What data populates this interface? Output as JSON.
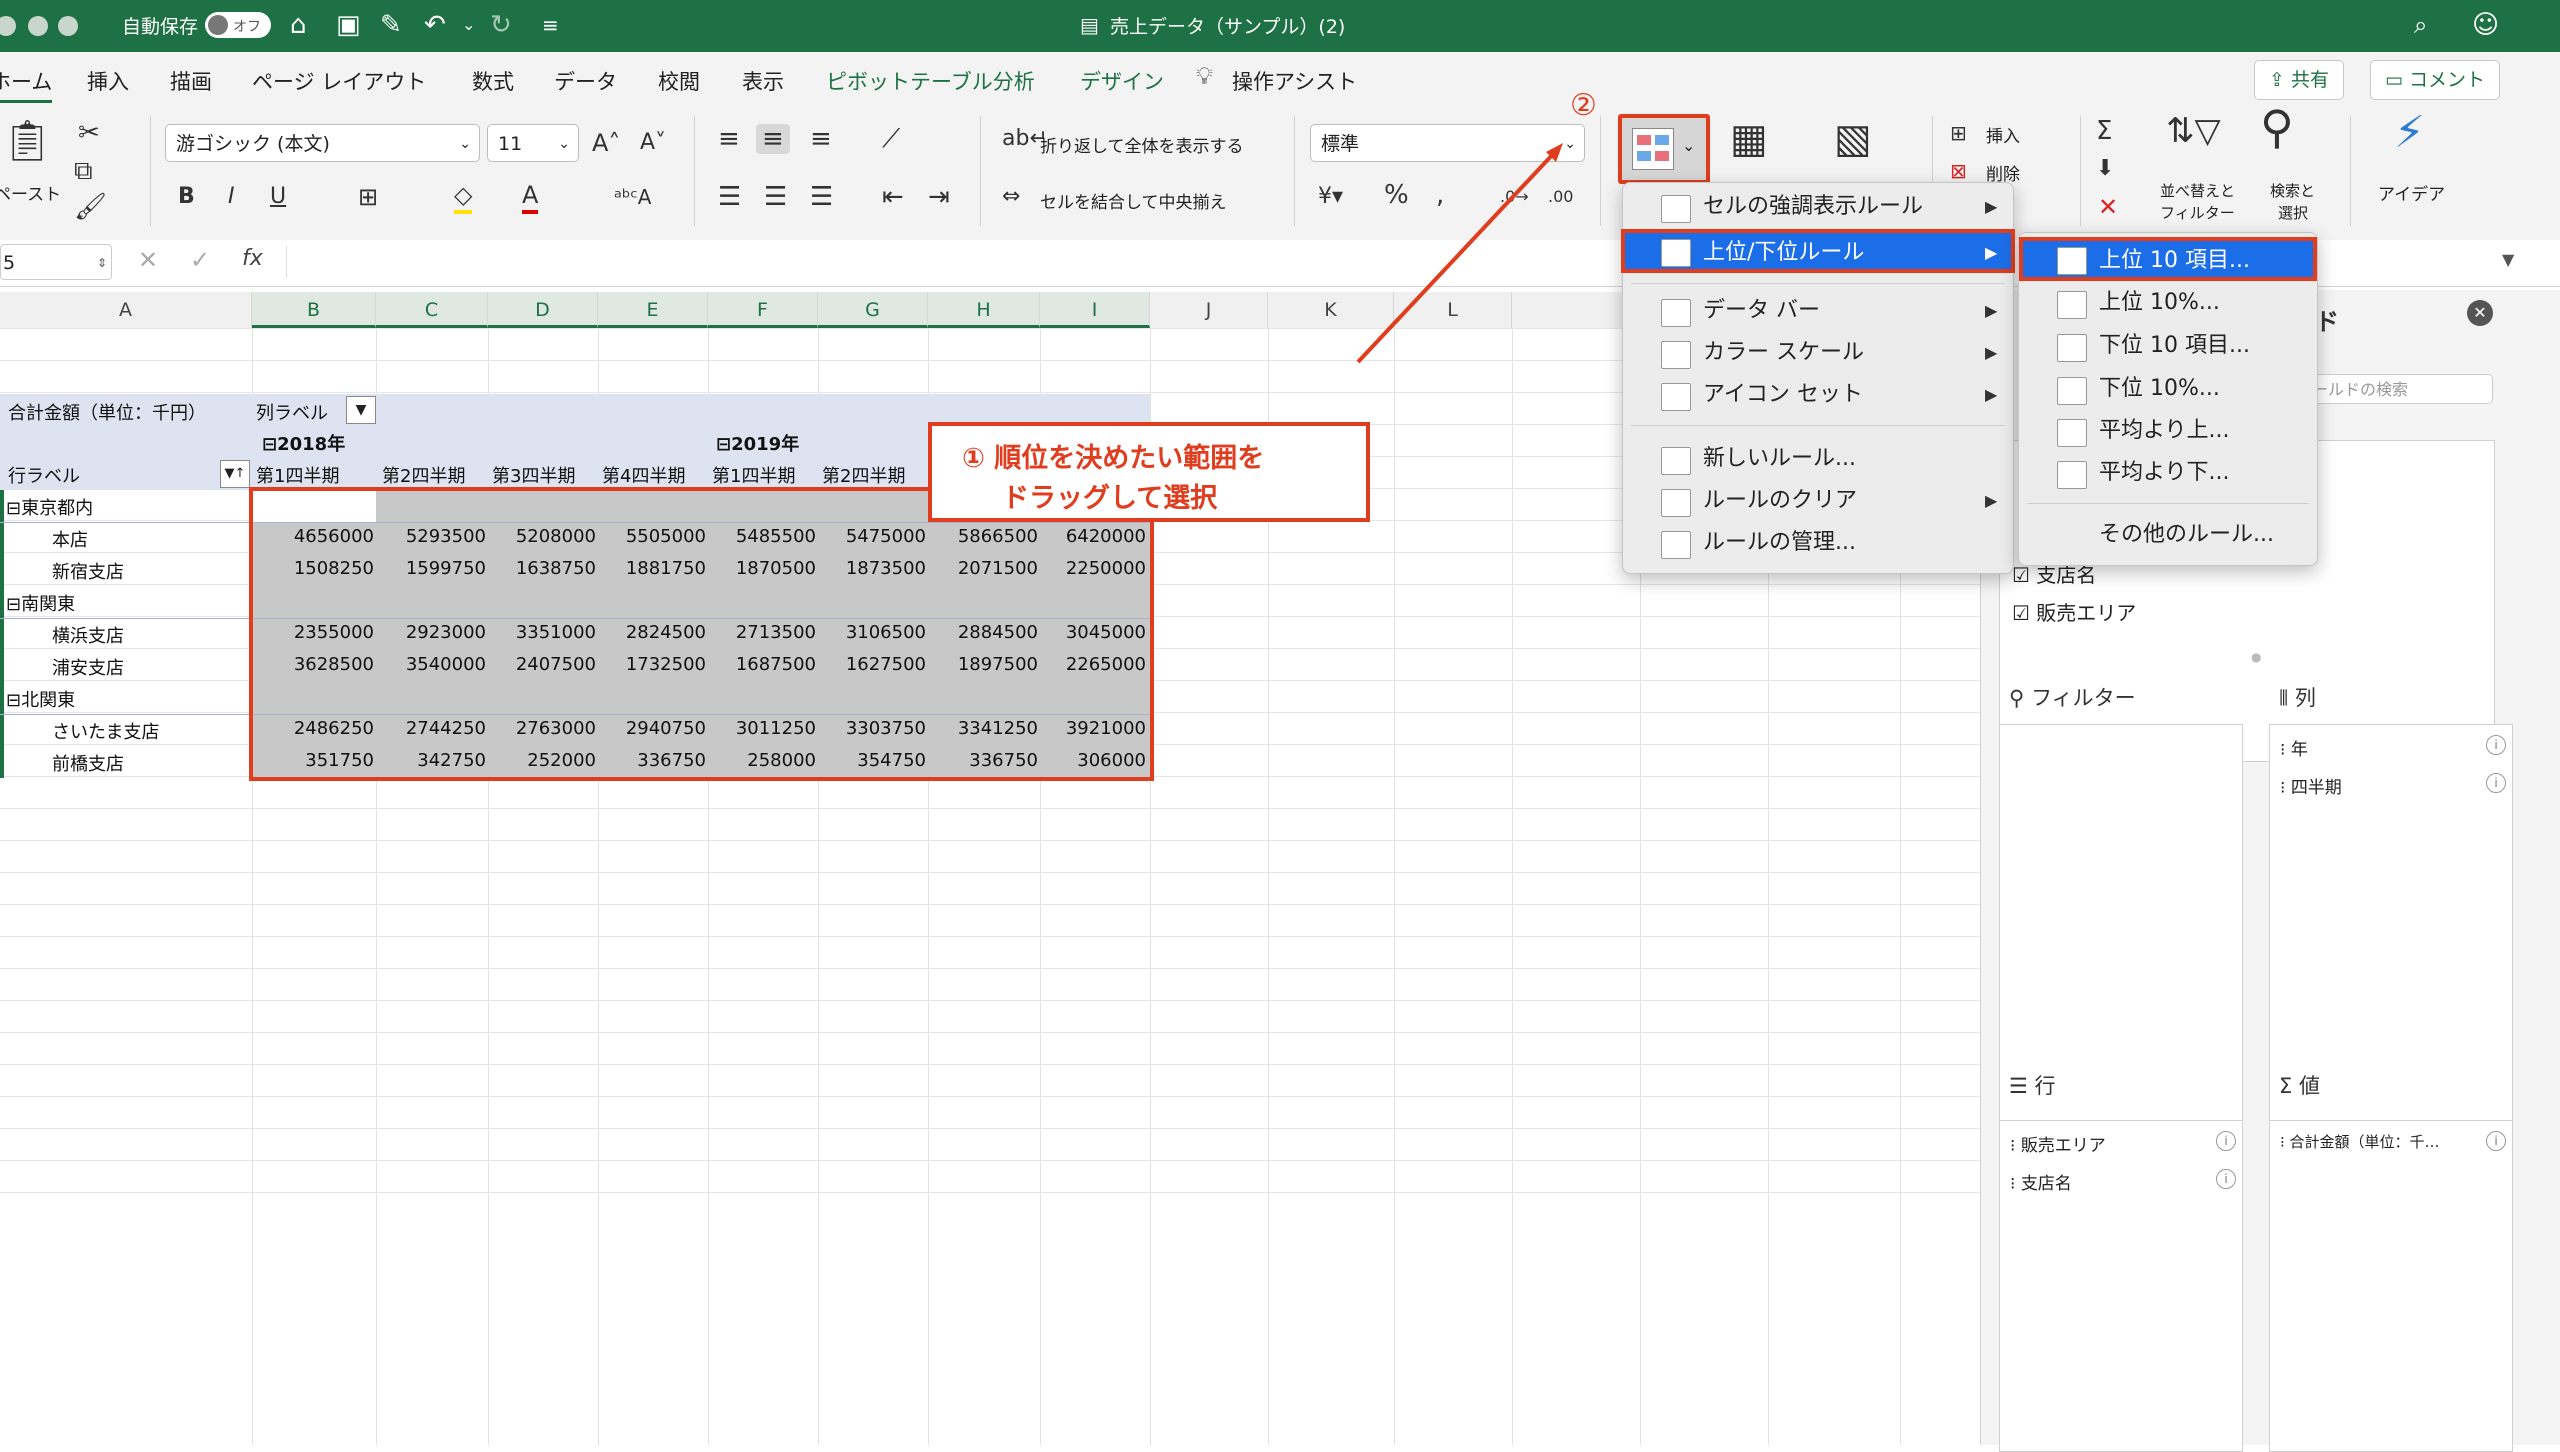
{
  "titlebar": {
    "autosave_label": "自動保存",
    "autosave_state": "オフ",
    "doc_title": "売上データ（サンプル）(2)",
    "icons": [
      "home-icon",
      "save-icon",
      "edit-icon",
      "undo-icon",
      "redo-icon",
      "customize-icon",
      "search-icon",
      "smiley-icon"
    ]
  },
  "tabs": [
    "ホーム",
    "挿入",
    "描画",
    "ページ レイアウト",
    "数式",
    "データ",
    "校閲",
    "表示",
    "ピボットテーブル分析",
    "デザイン",
    "操作アシスト"
  ],
  "share_label": "共有",
  "comment_label": "コメント",
  "ribbon": {
    "paste_label": "ペースト",
    "font_name": "游ゴシック (本文)",
    "font_size": "11",
    "bold": "B",
    "italic": "I",
    "underline": "U",
    "wrap_text": "折り返して全体を表示する",
    "merge_center": "セルを結合して中央揃え",
    "number_format": "標準",
    "insert_label": "挿入",
    "delete_label": "削除",
    "sort_filter": [
      "並べ替えと",
      "フィルター"
    ],
    "find_select": [
      "検索と",
      "選択"
    ],
    "ideas_label": "アイデア"
  },
  "formula_bar": {
    "name_box": "5",
    "fx": "fx"
  },
  "columns": [
    "A",
    "B",
    "C",
    "D",
    "E",
    "F",
    "G",
    "H",
    "I",
    "J",
    "K",
    "L"
  ],
  "pivot": {
    "corner_label": "合計金額（単位：千円）",
    "col_labels": "列ラベル",
    "row_labels": "行ラベル",
    "year_2018": "2018年",
    "year_2019": "2019年",
    "quarters": [
      "第1四半期",
      "第2四半期",
      "第3四半期",
      "第4四半期",
      "第1四半期",
      "第2四半期"
    ],
    "groups": [
      {
        "name": "東京都内",
        "rows": [
          {
            "name": "本店",
            "values": [
              "4656000",
              "5293500",
              "5208000",
              "5505000",
              "5485500",
              "5475000",
              "5866500",
              "6420000"
            ]
          },
          {
            "name": "新宿支店",
            "values": [
              "1508250",
              "1599750",
              "1638750",
              "1881750",
              "1870500",
              "1873500",
              "2071500",
              "2250000"
            ]
          }
        ]
      },
      {
        "name": "南関東",
        "rows": [
          {
            "name": "横浜支店",
            "values": [
              "2355000",
              "2923000",
              "3351000",
              "2824500",
              "2713500",
              "3106500",
              "2884500",
              "3045000"
            ]
          },
          {
            "name": "浦安支店",
            "values": [
              "3628500",
              "3540000",
              "2407500",
              "1732500",
              "1687500",
              "1627500",
              "1897500",
              "2265000"
            ]
          }
        ]
      },
      {
        "name": "北関東",
        "rows": [
          {
            "name": "さいたま支店",
            "values": [
              "2486250",
              "2744250",
              "2763000",
              "2940750",
              "3011250",
              "3303750",
              "3341250",
              "3921000"
            ]
          },
          {
            "name": "前橋支店",
            "values": [
              "351750",
              "342750",
              "252000",
              "336750",
              "258000",
              "354750",
              "336750",
              "306000"
            ]
          }
        ]
      }
    ]
  },
  "annotations": {
    "step1_line1": "① 順位を決めたい範囲を",
    "step1_line2": "ドラッグして選択",
    "step2": "②"
  },
  "menu": {
    "items": [
      "セルの強調表示ルール",
      "上位/下位ルール",
      "データ バー",
      "カラー スケール",
      "アイコン セット",
      "新しいルール...",
      "ルールのクリア",
      "ルールの管理..."
    ],
    "submenu": [
      "上位 10 項目...",
      "上位 10%...",
      "下位 10 項目...",
      "下位 10%...",
      "平均より上...",
      "平均より下...",
      "その他のルール..."
    ]
  },
  "pane": {
    "title_partial": "ルド",
    "search_placeholder": "ィールドの検索",
    "fields": [
      "支店名",
      "販売エリア"
    ],
    "filter_label": "フィルター",
    "columns_label": "列",
    "columns_items": [
      "年",
      "四半期"
    ],
    "rows_label": "行",
    "rows_items": [
      "販売エリア",
      "支店名"
    ],
    "values_label": "値",
    "values_items": [
      "合計金額（単位：千…"
    ]
  },
  "colors": {
    "excel_green": "#1e7145",
    "callout_red": "#e03c1e",
    "menu_highlight": "#1c6ee8",
    "pivot_header": "#dde3f1"
  }
}
